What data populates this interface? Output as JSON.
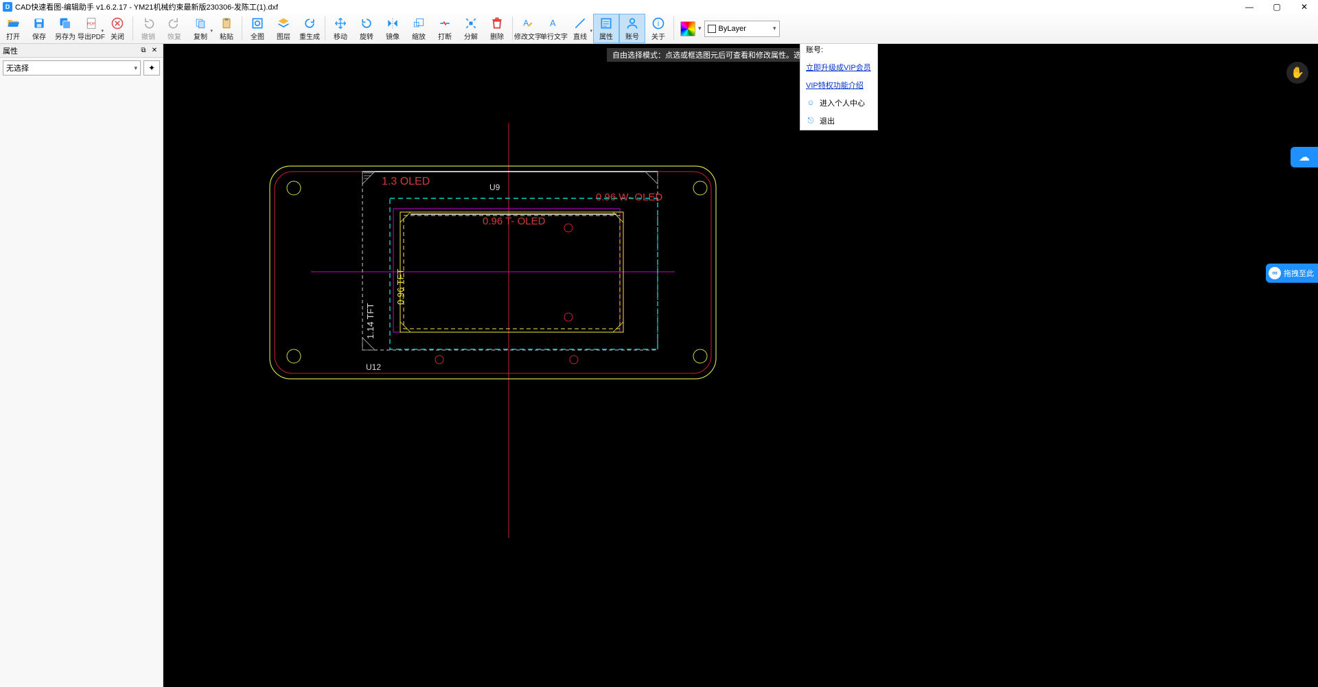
{
  "title": "CAD快速看图-编辑助手 v1.6.2.17 - YM21机械约束最新版230306-发陈工(1).dxf",
  "win": {
    "min": "—",
    "max": "▢",
    "close": "✕"
  },
  "toolbar": {
    "open": "打开",
    "save": "保存",
    "saveas": "另存为",
    "exportpdf": "导出PDF",
    "close": "关闭",
    "undo": "撤销",
    "redo": "恢复",
    "copy": "复制",
    "paste": "粘贴",
    "fullview": "全图",
    "layers": "图层",
    "regen": "重生成",
    "move": "移动",
    "rotate": "旋转",
    "mirror": "镜像",
    "scale": "缩放",
    "break": "打断",
    "explode": "分解",
    "delete": "删除",
    "edittext": "修改文字",
    "stext": "单行文字",
    "line": "直线",
    "props": "属性",
    "account": "账号",
    "about": "关于"
  },
  "layer": {
    "bylayer": "ByLayer"
  },
  "props_panel": {
    "title": "属性",
    "noselect": "无选择"
  },
  "hint": "自由选择模式：点选或框选图元后可查看和修改属性。选中后………相关操作",
  "account_menu": {
    "header": "账号:",
    "upgrade": "立即升级成VIP会员",
    "vip_intro": "VIP特权功能介绍",
    "profile": "进入个人中心",
    "logout": "退出"
  },
  "side": {
    "drag": "拖拽至此"
  },
  "drawing": {
    "label_13oled": "1.3  OLED",
    "label_u9": "U9",
    "label_096w": "0.96     W-  OLED",
    "label_096t": "0.96     T-  OLED",
    "label_096tft": "0.96 TFT",
    "label_114tft": "1.14  TFT",
    "label_u12": "U12"
  }
}
